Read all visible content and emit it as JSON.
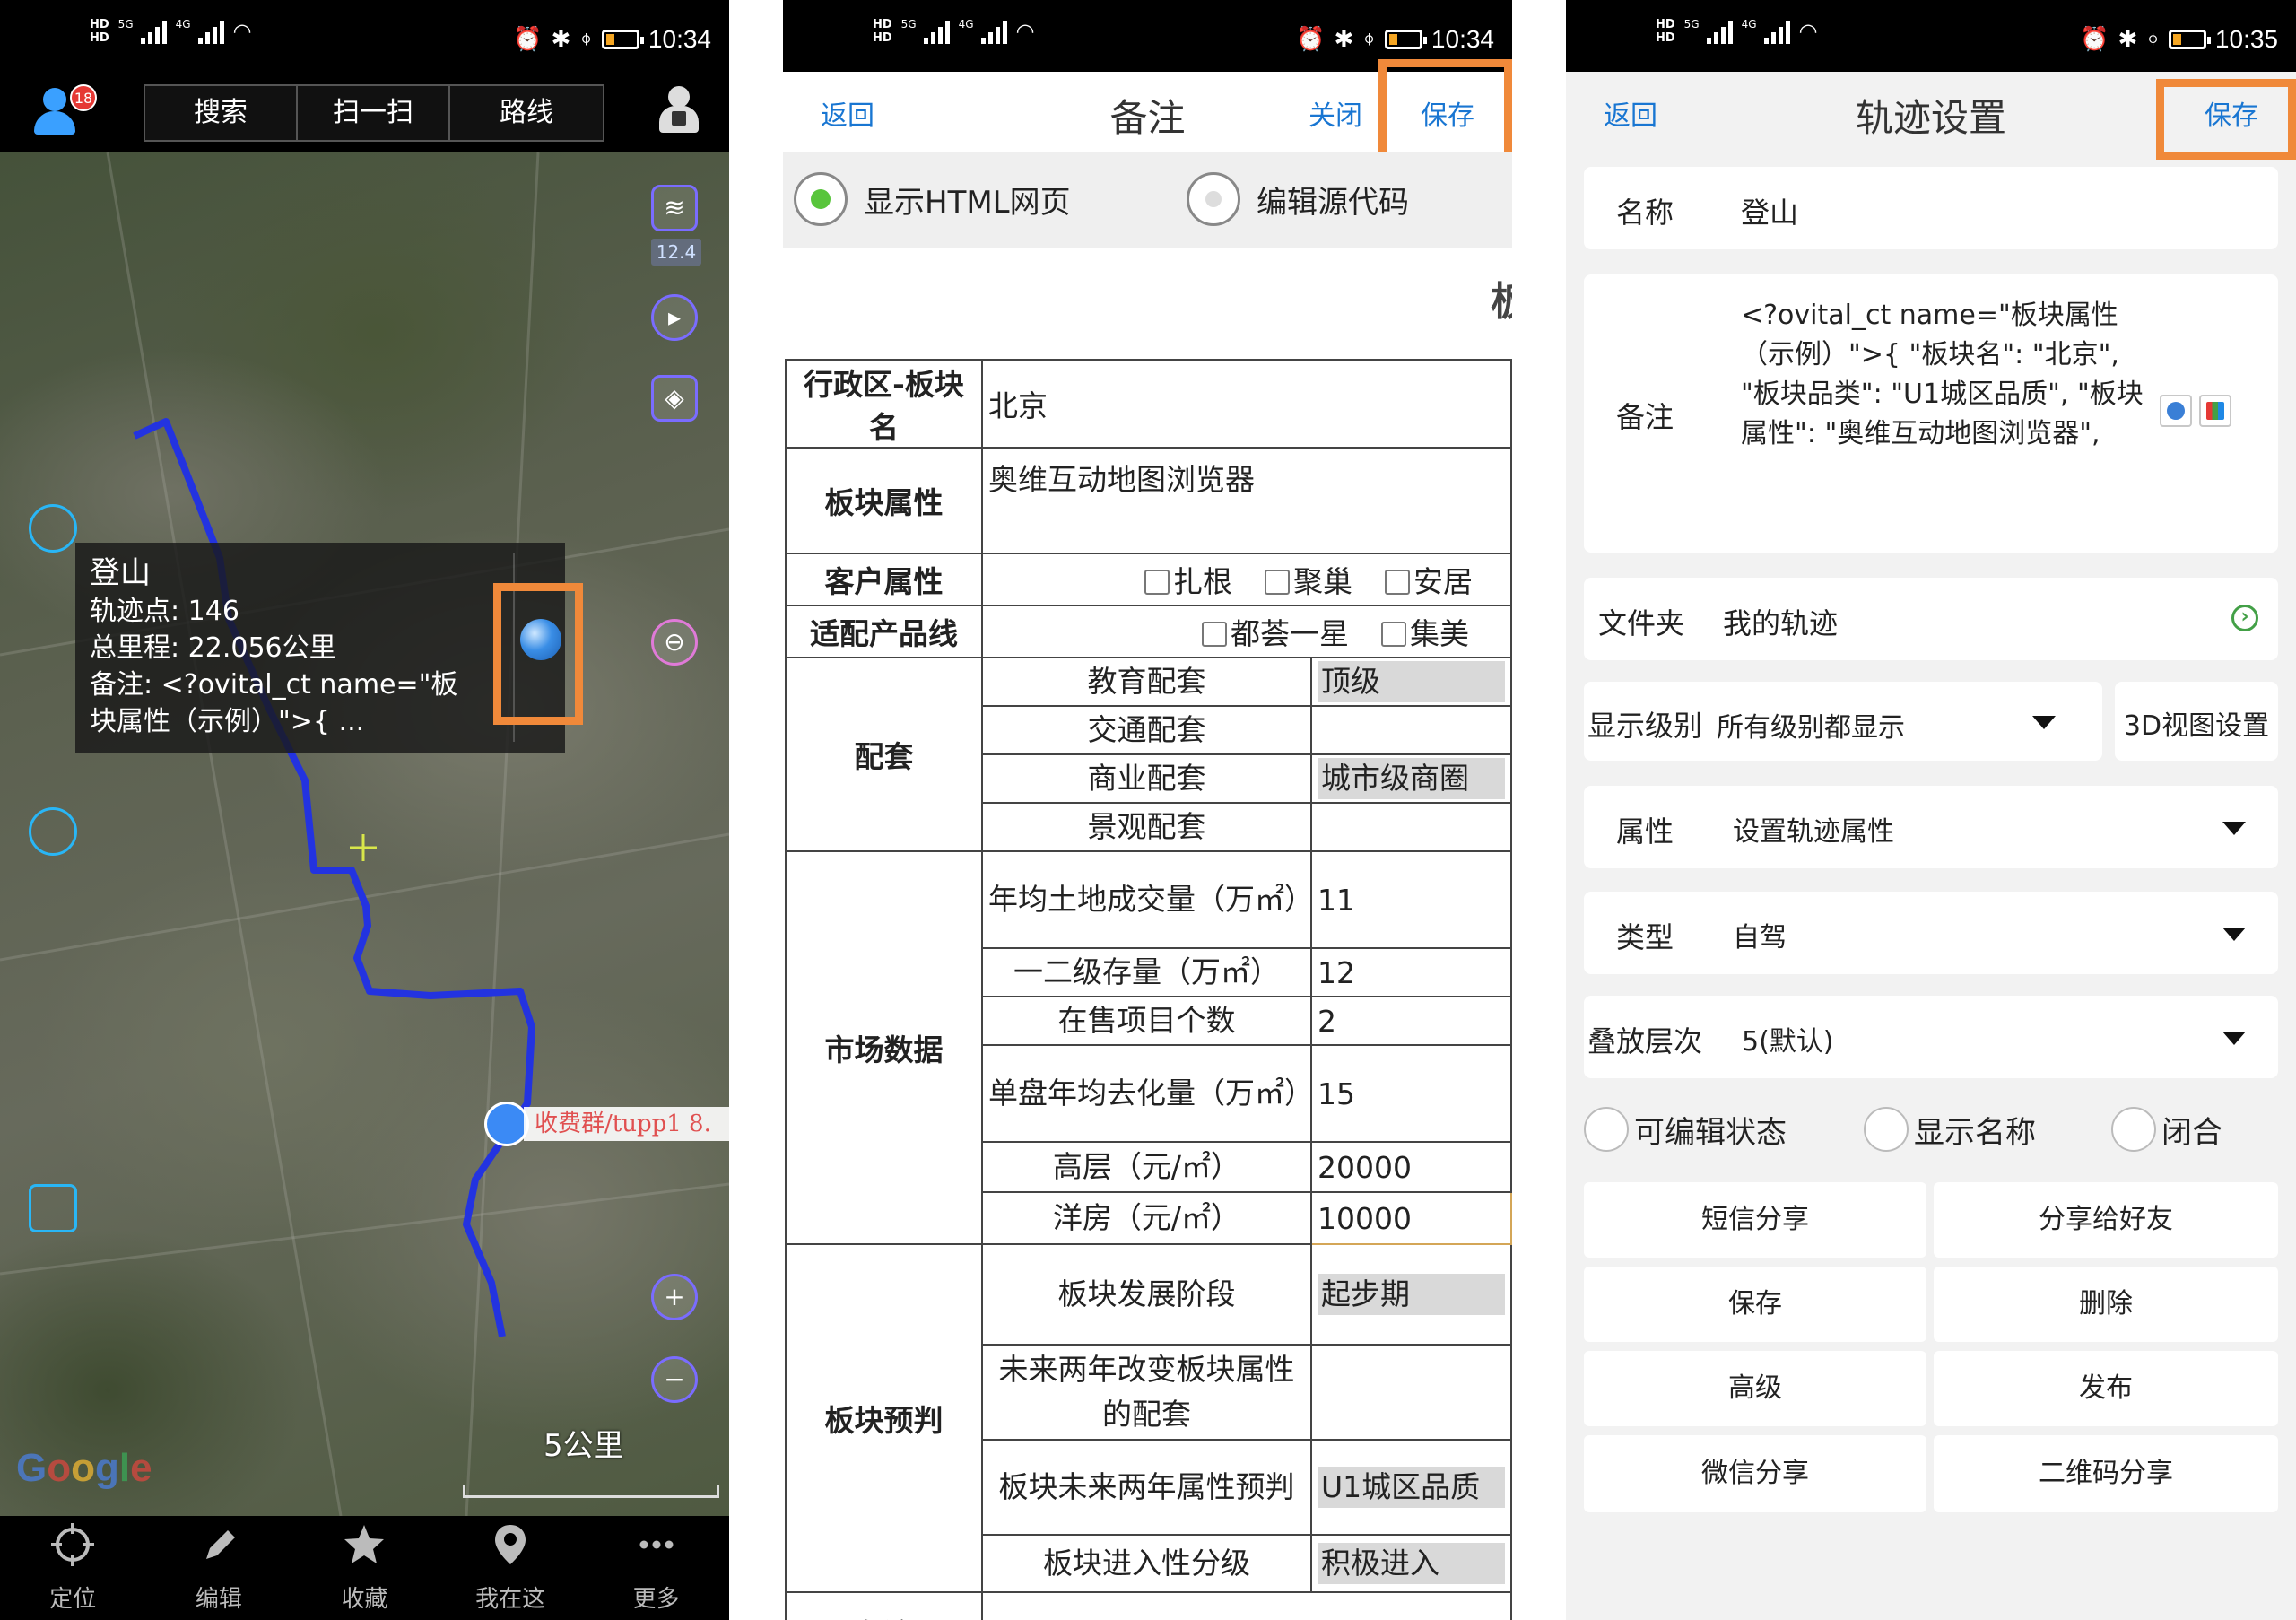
{
  "status_left": {
    "phone1": {
      "time": "10:34"
    },
    "phone2": {
      "time": "10:34"
    },
    "phone3": {
      "time": "10:35"
    }
  },
  "map_screen": {
    "notification_count": "18",
    "top_tabs": [
      "搜索",
      "扫一扫",
      "路线"
    ],
    "zoom_level": "12.4",
    "popup": {
      "title": "登山",
      "track_points": "轨迹点: 146",
      "total_distance": "总里程: 22.056公里",
      "note": "备注: <?ovital_ct name=\"板块属性（示例）\">{ ..."
    },
    "marker_label": "收费群/tupp1 8.",
    "scale": "5公里",
    "watermark": "Google",
    "nav": [
      "定位",
      "编辑",
      "收藏",
      "我在这",
      "更多"
    ]
  },
  "note_screen": {
    "back": "返回",
    "title": "备注",
    "close": "关闭",
    "save": "保存",
    "radio_html": "显示HTML网页",
    "radio_source": "编辑源代码",
    "cut_title": "板",
    "table": {
      "r1_h": "行政区-板块名",
      "r1_v": "北京",
      "r2_h": "板块属性",
      "r2_v": "奥维互动地图浏览器",
      "r3_h": "客户属性",
      "r3_opts": [
        "扎根",
        "聚巢",
        "安居"
      ],
      "r4_h": "适配产品线",
      "r4_opts": [
        "都荟一星",
        "集美"
      ],
      "peitao": "配套",
      "peitao_rows": [
        {
          "k": "教育配套",
          "v": "顶级"
        },
        {
          "k": "交通配套",
          "v": ""
        },
        {
          "k": "商业配套",
          "v": "城市级商圈"
        },
        {
          "k": "景观配套",
          "v": ""
        }
      ],
      "market": "市场数据",
      "market_rows": [
        {
          "k": "年均土地成交量（万㎡）",
          "v": "11"
        },
        {
          "k": "一二级存量（万㎡）",
          "v": "12"
        },
        {
          "k": "在售项目个数",
          "v": "2"
        },
        {
          "k": "单盘年均去化量（万㎡）",
          "v": "15"
        },
        {
          "k": "高层（元/㎡）",
          "v": "20000"
        },
        {
          "k": "洋房（元/㎡）",
          "v": "10000"
        }
      ],
      "forecast": "板块预判",
      "forecast_rows": [
        {
          "k": "板块发展阶段",
          "v": "起步期"
        },
        {
          "k": "未来两年改变板块属性的配套",
          "v": ""
        },
        {
          "k": "板块未来两年属性预判",
          "v": "U1城区品质"
        },
        {
          "k": "板块进入性分级",
          "v": "积极进入"
        }
      ],
      "remark": "备注"
    }
  },
  "track_screen": {
    "back": "返回",
    "title": "轨迹设置",
    "save": "保存",
    "name_label": "名称",
    "name_value": "登山",
    "note_label": "备注",
    "note_value": "<?ovital_ct name=\"板块属性（示例）\">{ \"板块名\": \"北京\", \"板块品类\": \"U1城区品质\", \"板块属性\": \"奥维互动地图浏览器\",",
    "folder_label": "文件夹",
    "folder_value": "我的轨迹",
    "level_label": "显示级别",
    "level_value": "所有级别都显示",
    "view3d_label": "3D视图设置",
    "attr_label": "属性",
    "attr_value": "设置轨迹属性",
    "type_label": "类型",
    "type_value": "自驾",
    "layer_label": "叠放层次",
    "layer_value": "5(默认)",
    "checks": [
      "可编辑状态",
      "显示名称",
      "闭合"
    ],
    "buttons": [
      "短信分享",
      "分享给好友",
      "保存",
      "删除",
      "高级",
      "发布",
      "微信分享",
      "二维码分享"
    ]
  },
  "colors": {
    "accent_blue": "#1976d2",
    "highlight_orange": "#f0893a",
    "track_blue": "#2333e0"
  }
}
